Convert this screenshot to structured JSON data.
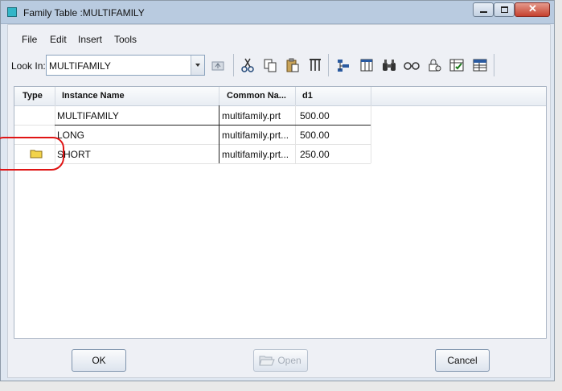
{
  "window": {
    "title": "Family Table :MULTIFAMILY"
  },
  "menu": [
    "File",
    "Edit",
    "Insert",
    "Tools"
  ],
  "toolbar": {
    "look_in_label": "Look In:",
    "look_in_value": "MULTIFAMILY"
  },
  "table": {
    "headers": [
      "Type",
      "Instance Name",
      "Common Na...",
      "d1"
    ],
    "rows": [
      {
        "type_icon": "",
        "instance": "MULTIFAMILY",
        "common": "multifamily.prt",
        "d1": "500.00"
      },
      {
        "type_icon": "",
        "instance": "LONG",
        "common": "multifamily.prt...",
        "d1": "500.00"
      },
      {
        "type_icon": "folder-icon",
        "instance": "SHORT",
        "common": "multifamily.prt...",
        "d1": "250.00"
      }
    ]
  },
  "buttons": {
    "ok": "OK",
    "open": "Open",
    "cancel": "Cancel"
  },
  "colors": {
    "annotation": "#e01515",
    "title_bar": "#b9cbe0",
    "folder": "#f2d34a"
  }
}
